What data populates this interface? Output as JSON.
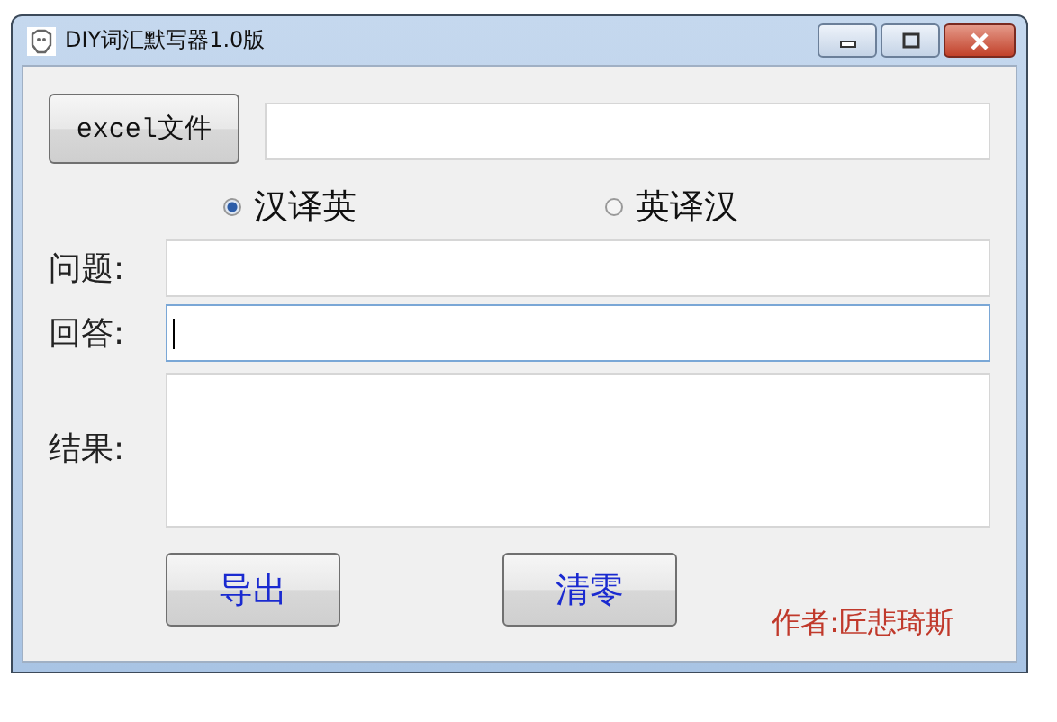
{
  "window": {
    "title": "DIY词汇默写器1.0版"
  },
  "file_button": "excel文件",
  "modes": [
    {
      "label": "汉译英",
      "selected": true
    },
    {
      "label": "英译汉",
      "selected": false
    }
  ],
  "fields": [
    {
      "label": "问题:",
      "kind": "line",
      "focused": false
    },
    {
      "label": "回答:",
      "kind": "line",
      "focused": true
    },
    {
      "label": "结果:",
      "kind": "area",
      "focused": false
    }
  ],
  "buttons": [
    "导出",
    "清零"
  ],
  "author": "作者:匠悲琦斯"
}
